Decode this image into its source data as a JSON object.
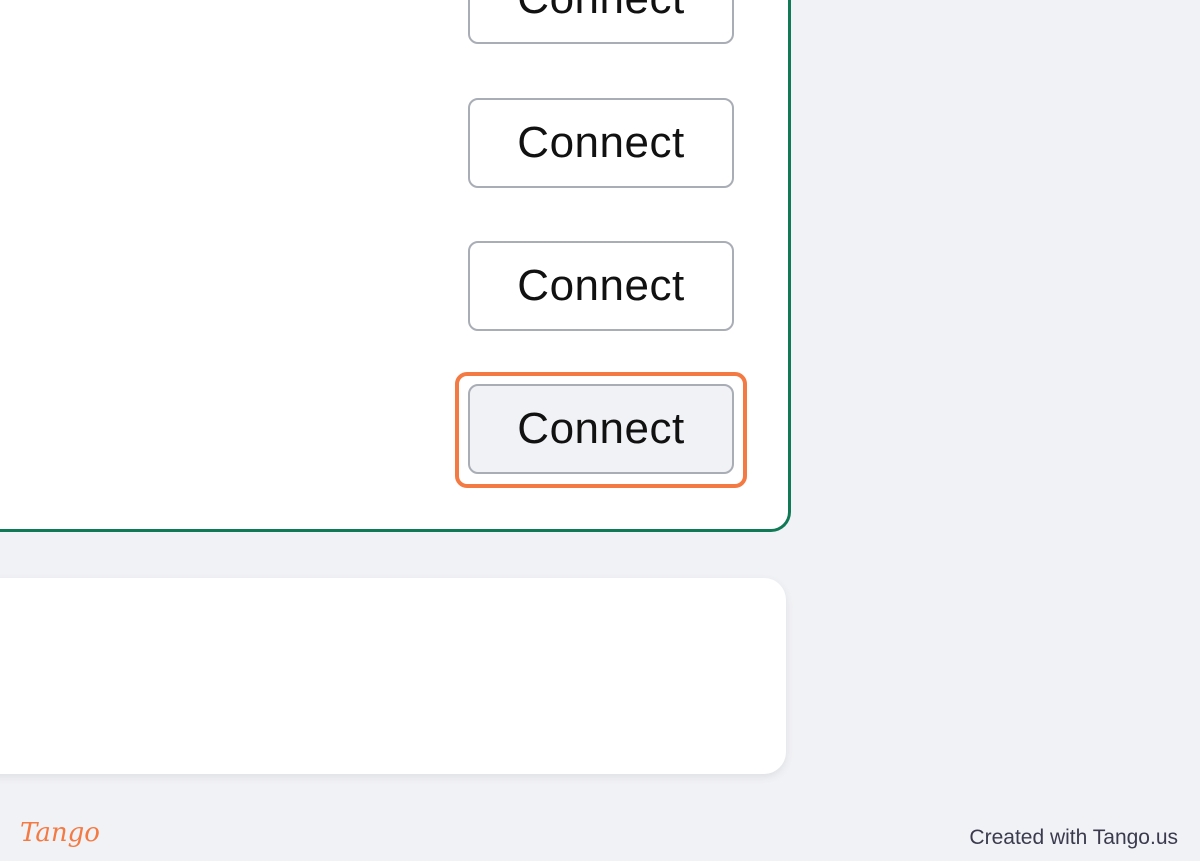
{
  "buttons": [
    {
      "label": "Connect"
    },
    {
      "label": "Connect"
    },
    {
      "label": "Connect"
    },
    {
      "label": "Connect"
    }
  ],
  "footer": {
    "logo": "Tango",
    "credit": "Created with Tango.us"
  },
  "colors": {
    "accent_border": "#0f7a55",
    "highlight": "#f47a44",
    "background": "#f1f2f5"
  }
}
